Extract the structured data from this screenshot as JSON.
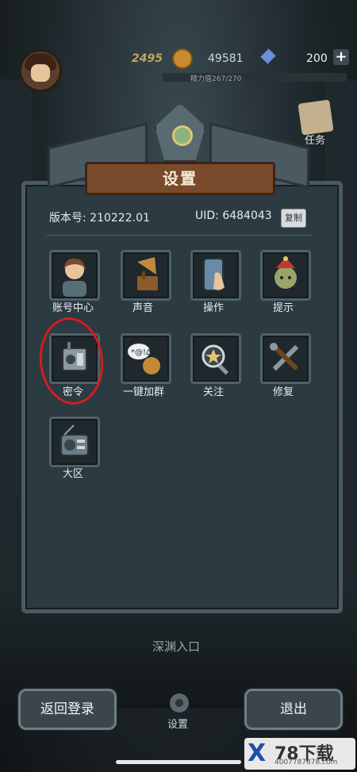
{
  "hud": {
    "level": "2495",
    "gold": "49581",
    "diamonds": "200",
    "plus_label": "+",
    "energy_text": "精力值267/270",
    "task_label": "任务"
  },
  "dialog": {
    "title": "设置",
    "version_label": "版本号:",
    "version_value": "210222.01",
    "uid_label": "UID:",
    "uid_value": "6484043",
    "copy_label": "复制",
    "items": [
      {
        "label": "账号中心",
        "icon": "account-icon"
      },
      {
        "label": "声音",
        "icon": "gramophone-icon"
      },
      {
        "label": "操作",
        "icon": "phone-tap-icon"
      },
      {
        "label": "提示",
        "icon": "goblin-hint-icon"
      },
      {
        "label": "密令",
        "icon": "radio-device-icon"
      },
      {
        "label": "一键加群",
        "icon": "chat-group-icon"
      },
      {
        "label": "关注",
        "icon": "magnifier-star-icon"
      },
      {
        "label": "修复",
        "icon": "wrench-screwdriver-icon"
      },
      {
        "label": "大区",
        "icon": "radio-icon"
      }
    ]
  },
  "scene": {
    "abyss_label": "深渊入口",
    "settings_label": "设置"
  },
  "buttons": {
    "back_login": "返回登录",
    "exit": "退出"
  },
  "watermark": {
    "logo_x": "X",
    "logo_text": "78下载",
    "logo_url": "4007787878.com"
  },
  "colors": {
    "dialog_bg": "#2c3a42",
    "title_plate": "#7a4a2c",
    "highlight_circle": "#d11e1e"
  }
}
